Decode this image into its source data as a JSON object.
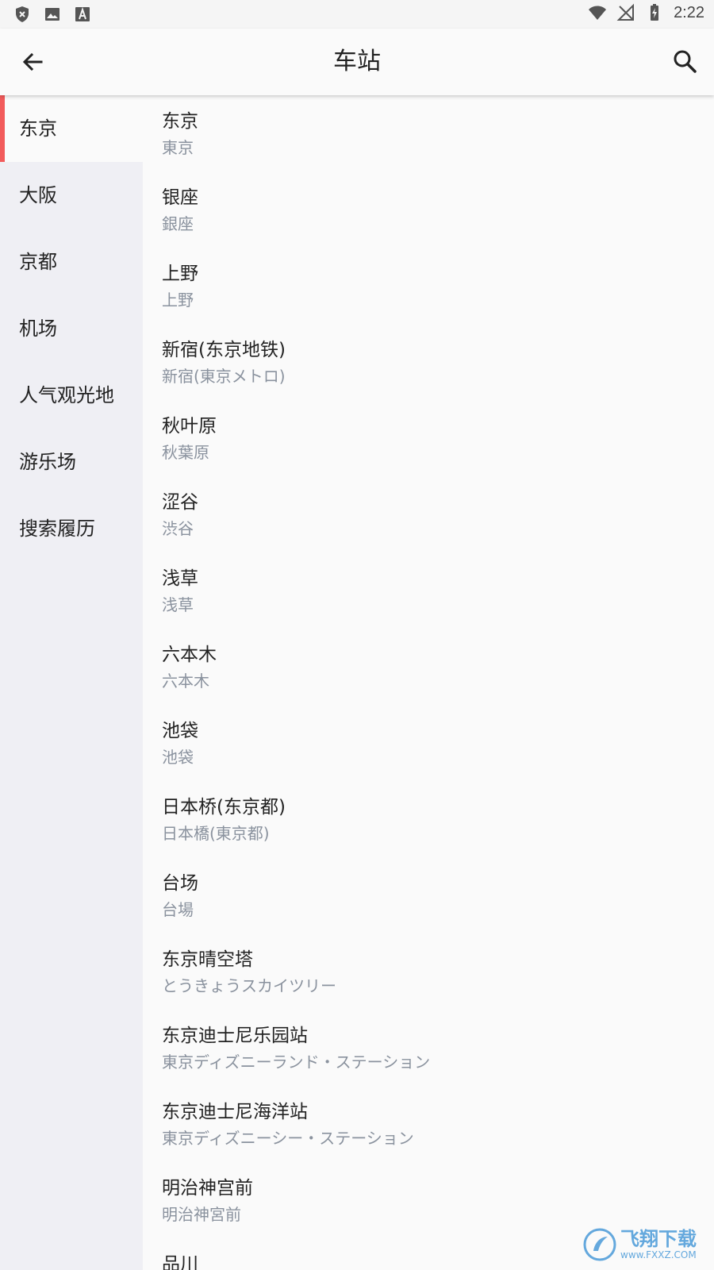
{
  "statusbar": {
    "time": "2:22",
    "icons": [
      "shield-x-icon",
      "image-icon",
      "font-a-icon",
      "wifi-icon",
      "no-signal-icon",
      "battery-charging-icon"
    ]
  },
  "appbar": {
    "title": "车站",
    "back_icon": "arrow-left-icon",
    "search_icon": "search-icon"
  },
  "sidebar": {
    "active_color": "#f25b5b",
    "items": [
      {
        "label": "东京",
        "active": true
      },
      {
        "label": "大阪",
        "active": false
      },
      {
        "label": "京都",
        "active": false
      },
      {
        "label": "机场",
        "active": false
      },
      {
        "label": "人气观光地",
        "active": false
      },
      {
        "label": "游乐场",
        "active": false
      },
      {
        "label": "搜索履历",
        "active": false
      }
    ]
  },
  "stations": [
    {
      "name": "东京",
      "sub": "東京"
    },
    {
      "name": "银座",
      "sub": "銀座"
    },
    {
      "name": "上野",
      "sub": "上野"
    },
    {
      "name": "新宿(东京地铁)",
      "sub": "新宿(東京メトロ)"
    },
    {
      "name": "秋叶原",
      "sub": "秋葉原"
    },
    {
      "name": "涩谷",
      "sub": "渋谷"
    },
    {
      "name": "浅草",
      "sub": "浅草"
    },
    {
      "name": "六本木",
      "sub": "六本木"
    },
    {
      "name": "池袋",
      "sub": "池袋"
    },
    {
      "name": "日本桥(东京都)",
      "sub": "日本橋(東京都)"
    },
    {
      "name": "台场",
      "sub": "台場"
    },
    {
      "name": "东京晴空塔",
      "sub": "とうきょうスカイツリー"
    },
    {
      "name": "东京迪士尼乐园站",
      "sub": "東京ディズニーランド・ステーション"
    },
    {
      "name": "东京迪士尼海洋站",
      "sub": "東京ディズニーシー・ステーション"
    },
    {
      "name": "明治神宫前",
      "sub": "明治神宮前"
    },
    {
      "name": "品川",
      "sub": ""
    }
  ],
  "watermark": {
    "cn": "飞翔下载",
    "en": "www.FXXZ.COM"
  }
}
